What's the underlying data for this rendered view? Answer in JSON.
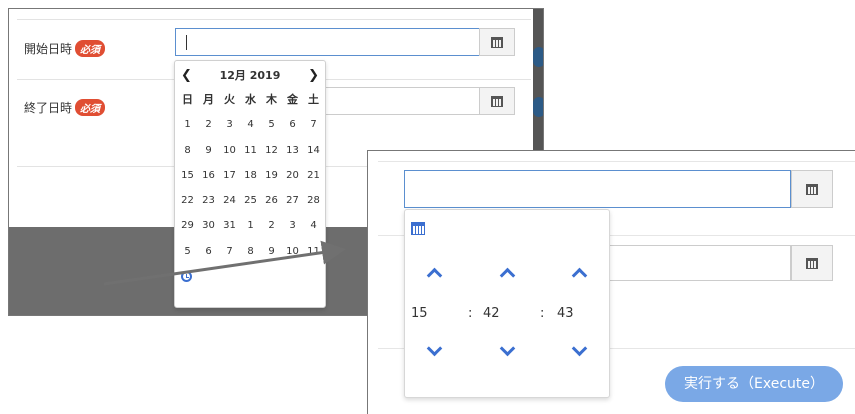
{
  "form": {
    "start_label": "開始日時",
    "end_label": "終了日時",
    "required_badge": "必須"
  },
  "datepicker": {
    "prev": "❮",
    "next": "❯",
    "month_title": "12月 2019",
    "weekdays": [
      "日",
      "月",
      "火",
      "水",
      "木",
      "金",
      "土"
    ],
    "days": [
      "1",
      "2",
      "3",
      "4",
      "5",
      "6",
      "7",
      "8",
      "9",
      "10",
      "11",
      "12",
      "13",
      "14",
      "15",
      "16",
      "17",
      "18",
      "19",
      "20",
      "21",
      "22",
      "23",
      "24",
      "25",
      "26",
      "27",
      "28",
      "29",
      "30",
      "31",
      "1",
      "2",
      "3",
      "4",
      "5",
      "6",
      "7",
      "8",
      "9",
      "10",
      "11"
    ]
  },
  "timepicker": {
    "hour": "15",
    "minute": "42",
    "second": "43",
    "separator": ":"
  },
  "execute_button": "実行する（Execute）",
  "icons": {
    "calendar": "calendar-icon",
    "clock": "clock-icon",
    "chevron_up": "chevron-up-icon",
    "chevron_down": "chevron-down-icon"
  },
  "colors": {
    "required": "#e04e33",
    "accent": "#3b6fd0",
    "execute": "#7aa8e6",
    "backdrop": "#6d6d6d"
  }
}
